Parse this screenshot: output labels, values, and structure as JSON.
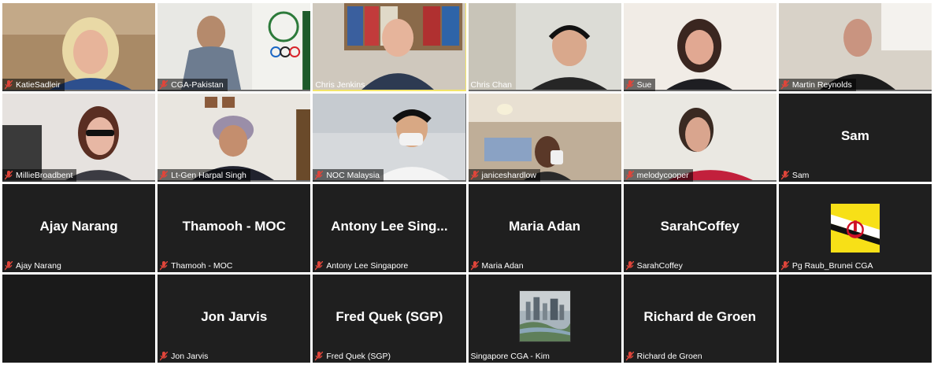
{
  "meeting": {
    "participants": [
      {
        "label": "KatieSadleir",
        "muted": true,
        "video": true
      },
      {
        "label": "CGA-Pakistan",
        "muted": true,
        "video": true
      },
      {
        "label": "Chris Jenkins",
        "muted": false,
        "video": true,
        "active_speaker": true
      },
      {
        "label": "Chris Chan",
        "muted": false,
        "video": true
      },
      {
        "label": "Sue",
        "muted": true,
        "video": true
      },
      {
        "label": "Martin Reynolds",
        "muted": true,
        "video": true
      },
      {
        "label": "MillieBroadbent",
        "muted": true,
        "video": true
      },
      {
        "label": "Lt-Gen Harpal Singh",
        "muted": true,
        "video": true
      },
      {
        "label": "NOC Malaysia",
        "muted": true,
        "video": true
      },
      {
        "label": "janiceshardlow",
        "muted": true,
        "video": true
      },
      {
        "label": "melodycooper",
        "muted": true,
        "video": true
      },
      {
        "label": "Sam",
        "display_name": "Sam",
        "muted": true,
        "video": false
      },
      {
        "label": "Ajay Narang",
        "display_name": "Ajay Narang",
        "muted": true,
        "video": false
      },
      {
        "label": "Thamooh - MOC",
        "display_name": "Thamooh - MOC",
        "muted": true,
        "video": false
      },
      {
        "label": "Antony Lee Singapore",
        "display_name": "Antony Lee Sing...",
        "muted": true,
        "video": false
      },
      {
        "label": "Maria Adan",
        "display_name": "Maria Adan",
        "muted": true,
        "video": false
      },
      {
        "label": "SarahCoffey",
        "display_name": "SarahCoffey",
        "muted": true,
        "video": false
      },
      {
        "label": "Pg Raub_Brunei CGA",
        "muted": true,
        "video": false,
        "avatar": "brunei-flag"
      },
      {
        "label": "",
        "empty": true
      },
      {
        "label": "Jon Jarvis",
        "display_name": "Jon Jarvis",
        "muted": true,
        "video": false
      },
      {
        "label": "Fred Quek (SGP)",
        "display_name": "Fred Quek (SGP)",
        "muted": true,
        "video": false
      },
      {
        "label": "Singapore CGA - Kim",
        "muted": false,
        "video": false,
        "avatar": "city-photo"
      },
      {
        "label": "Richard de Groen",
        "display_name": "Richard de Groen",
        "muted": true,
        "video": false
      },
      {
        "label": "",
        "empty": true
      }
    ]
  },
  "colors": {
    "muted_icon": "#e0453a",
    "active_speaker_border": "#f4e66a",
    "tile_background": "#1f1f1f"
  }
}
